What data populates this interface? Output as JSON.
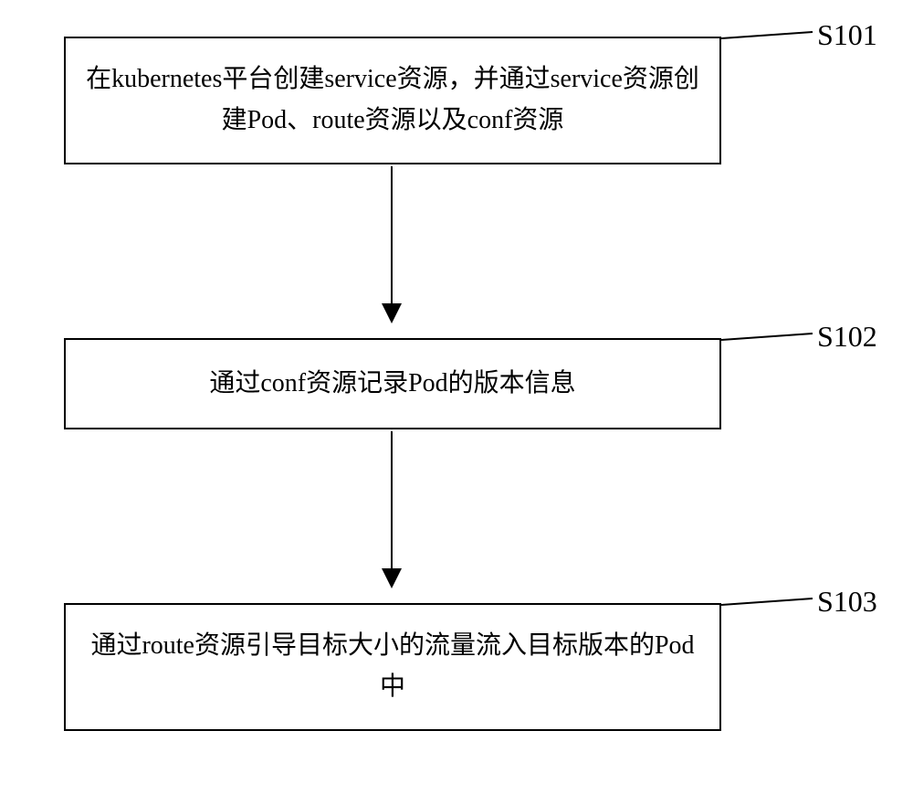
{
  "steps": [
    {
      "id": "S101",
      "text": "在kubernetes平台创建service资源，并通过service资源创建Pod、route资源以及conf资源"
    },
    {
      "id": "S102",
      "text": "通过conf资源记录Pod的版本信息"
    },
    {
      "id": "S103",
      "text": "通过route资源引导目标大小的流量流入目标版本的Pod中"
    }
  ]
}
